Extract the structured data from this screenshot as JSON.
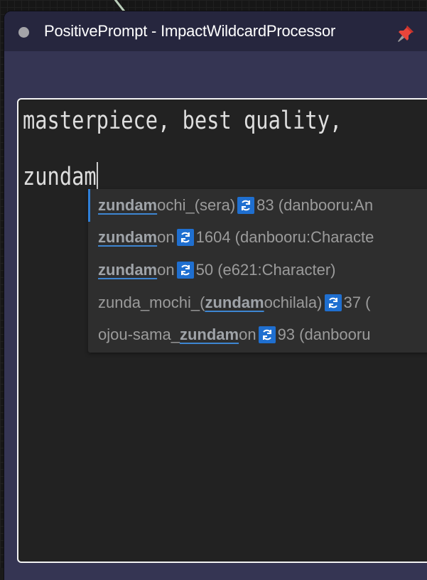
{
  "node": {
    "title": "PositivePrompt - ImpactWildcardProcessor",
    "pin_icon": "pin-icon"
  },
  "prompt": {
    "line1": "masterpiece, best quality,",
    "line2": "zundam"
  },
  "autocomplete": {
    "items": [
      {
        "match": "zundam",
        "prefix": "",
        "rest": "ochi_(sera)",
        "count_info": "83 (danbooru:An"
      },
      {
        "match": "zundam",
        "prefix": "",
        "rest": "on",
        "count_info": "1604 (danbooru:Characte"
      },
      {
        "match": "zundam",
        "prefix": "",
        "rest": "on",
        "count_info": "50 (e621:Character)"
      },
      {
        "match": "zundam",
        "prefix": "zunda_mochi_(",
        "rest": "ochilala)",
        "count_info": "37 ("
      },
      {
        "match": "zundam",
        "prefix": "ojou-sama_",
        "rest": "on",
        "count_info": "93 (danbooru"
      }
    ],
    "icon": "refresh-icon",
    "selected_index": 0
  },
  "colors": {
    "node_body": "#353553",
    "node_title": "#26263e",
    "textarea_bg": "#222222",
    "accent": "#2f7fd8"
  }
}
